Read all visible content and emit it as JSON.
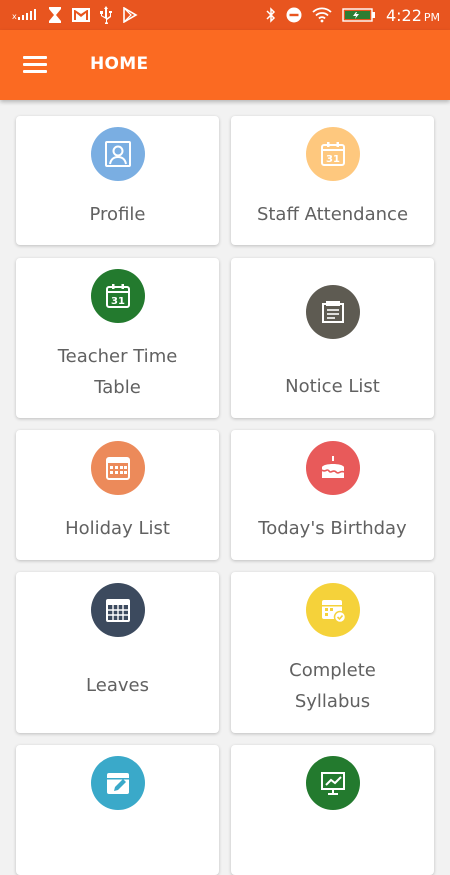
{
  "status_bar": {
    "time": "4:22",
    "ampm": "PM",
    "icons": [
      "signal-icon",
      "hourglass-icon",
      "gmail-icon",
      "usb-icon",
      "play-store-icon",
      "bluetooth-icon",
      "do-not-disturb-icon",
      "wifi-icon",
      "battery-icon"
    ]
  },
  "app_bar": {
    "title": "HOME",
    "menu_icon": "hamburger-menu-icon"
  },
  "colors": {
    "status_bar": "#e8551f",
    "app_bar": "#fb6a22",
    "background": "#f2f2f2",
    "card": "#ffffff",
    "label": "#616161"
  },
  "tiles": [
    {
      "label_lines": [
        "Profile"
      ],
      "icon": "profile-icon",
      "color": "#7aaee2"
    },
    {
      "label_lines": [
        "Staff Attendance"
      ],
      "icon": "calendar-31-icon",
      "color": "#fec87e"
    },
    {
      "label_lines": [
        "Teacher Time",
        "Table"
      ],
      "icon": "calendar-31-icon",
      "color": "#237a2e"
    },
    {
      "label_lines": [
        "Notice List"
      ],
      "icon": "notice-icon",
      "color": "#5e5b52"
    },
    {
      "label_lines": [
        "Holiday List"
      ],
      "icon": "calendar-grid-icon",
      "color": "#ec8a5a"
    },
    {
      "label_lines": [
        "Today's Birthday"
      ],
      "icon": "birthday-cake-icon",
      "color": "#e85a5a"
    },
    {
      "label_lines": [
        "Leaves"
      ],
      "icon": "calendar-cross-icon",
      "color": "#3c4a5e"
    },
    {
      "label_lines": [
        "Complete",
        "Syllabus"
      ],
      "icon": "calendar-check-icon",
      "color": "#f5d23a"
    },
    {
      "label_lines": [],
      "icon": "calendar-edit-icon",
      "color": "#3aa9c9"
    },
    {
      "label_lines": [],
      "icon": "presentation-chart-icon",
      "color": "#237a2e"
    }
  ]
}
